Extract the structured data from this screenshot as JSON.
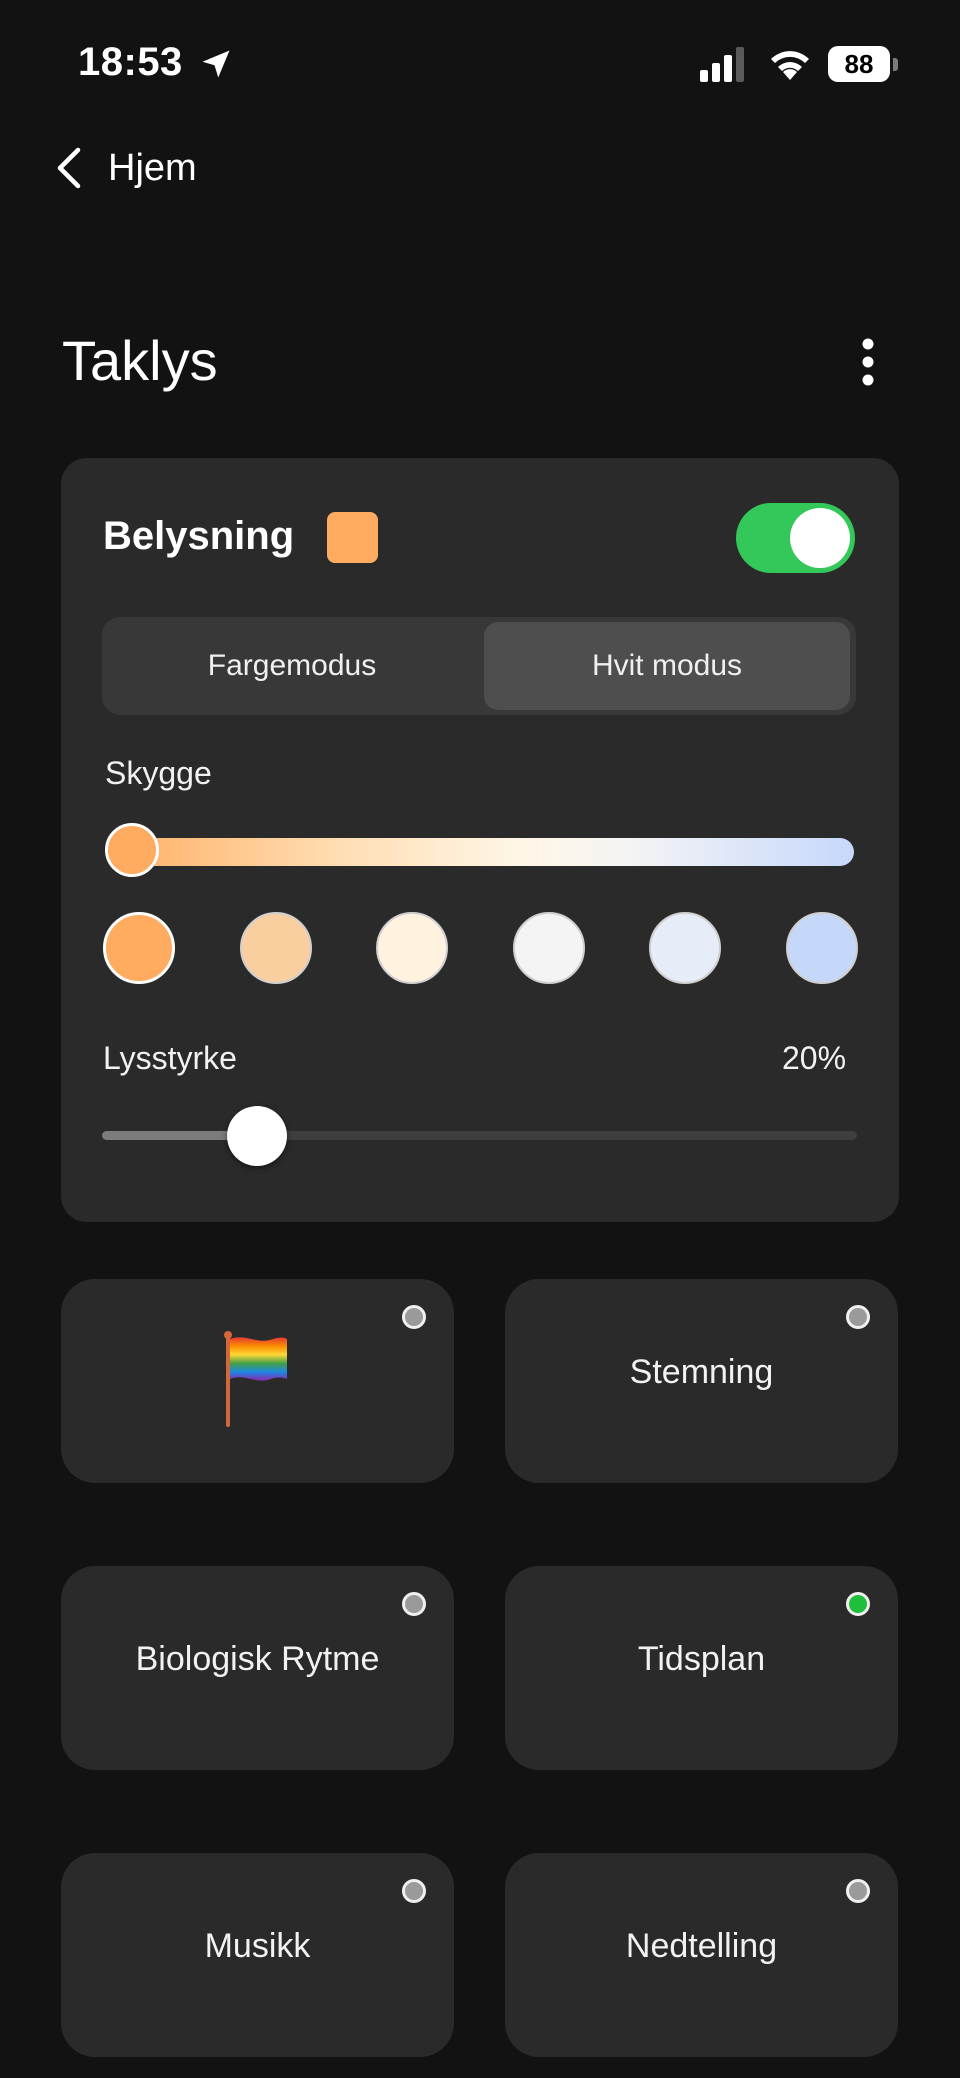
{
  "status_bar": {
    "time": "18:53",
    "battery": "88"
  },
  "nav": {
    "back_label": "Hjem"
  },
  "page": {
    "title": "Taklys"
  },
  "lighting_card": {
    "title": "Belysning",
    "power_on": true,
    "chip_color": "#ffab60",
    "modes": {
      "color_mode": "Fargemodus",
      "white_mode": "Hvit modus",
      "selected": "Hvit modus"
    },
    "shade": {
      "label": "Skygge",
      "swatches": [
        "#ffab60",
        "#f9cfa0",
        "#fff2de",
        "#f4f4f4",
        "#e6ecf8",
        "#c6d8fa"
      ],
      "selected_index": 0
    },
    "brightness": {
      "label": "Lysstyrke",
      "value_text": "20%",
      "value": 20
    }
  },
  "tiles": [
    {
      "label": "",
      "icon": "rainbow-flag-icon",
      "active": false
    },
    {
      "label": "Stemning",
      "active": false
    },
    {
      "label": "Biologisk Rytme",
      "active": false
    },
    {
      "label": "Tidsplan",
      "active": true
    },
    {
      "label": "Musikk",
      "active": false
    },
    {
      "label": "Nedtelling",
      "active": false
    }
  ],
  "colors": {
    "accent_green": "#34c759",
    "tile_active": "#1fbf3a",
    "background": "#121212",
    "card": "#2a2a2a"
  }
}
